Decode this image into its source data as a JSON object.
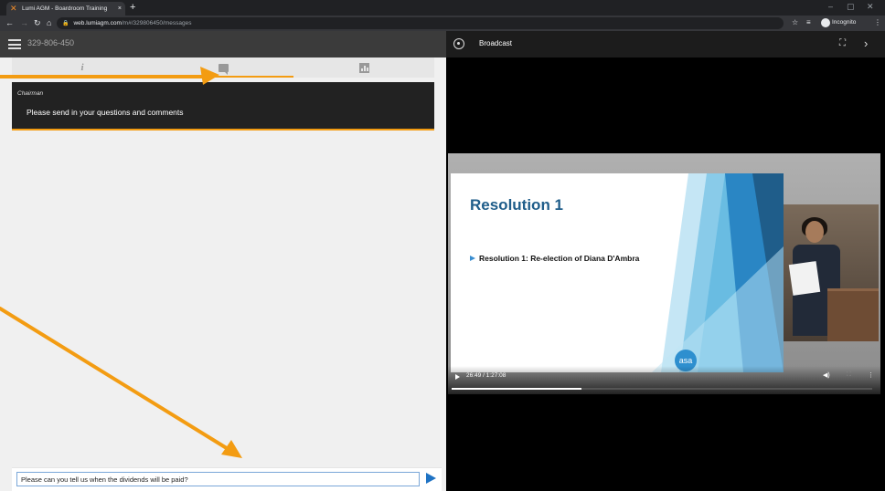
{
  "browser": {
    "tab_title": "Lumi AGM - Boardroom Training",
    "tab_close": "×",
    "new_tab": "+",
    "url_host": "web.lumiagm.com",
    "url_path": "/m#/329806450/messages",
    "incognito_label": "Incognito",
    "window_controls": [
      "–",
      "▢",
      "✕"
    ]
  },
  "app": {
    "meeting_id": "329-806-450",
    "tabs": [
      {
        "name": "info",
        "icon": "info-icon",
        "active": false
      },
      {
        "name": "messages",
        "icon": "chat-icon",
        "active": true
      },
      {
        "name": "polls",
        "icon": "chart-icon",
        "active": false
      }
    ],
    "messages": [
      {
        "sender": "Chairman",
        "text": "Please send in your questions and comments"
      }
    ],
    "composer": {
      "value": "Please can you tell us when the dividends will be paid?"
    },
    "accent_color": "#f39c12"
  },
  "broadcast": {
    "title": "Broadcast",
    "slide": {
      "title": "Resolution 1",
      "bullet": "Resolution 1: Re-election of Diana D'Ambra",
      "logo_text": "asa"
    },
    "player": {
      "time": "26:49 / 1:27:08",
      "progress": 0.308
    }
  },
  "annotations": {
    "arrow_color": "#f39c12"
  }
}
